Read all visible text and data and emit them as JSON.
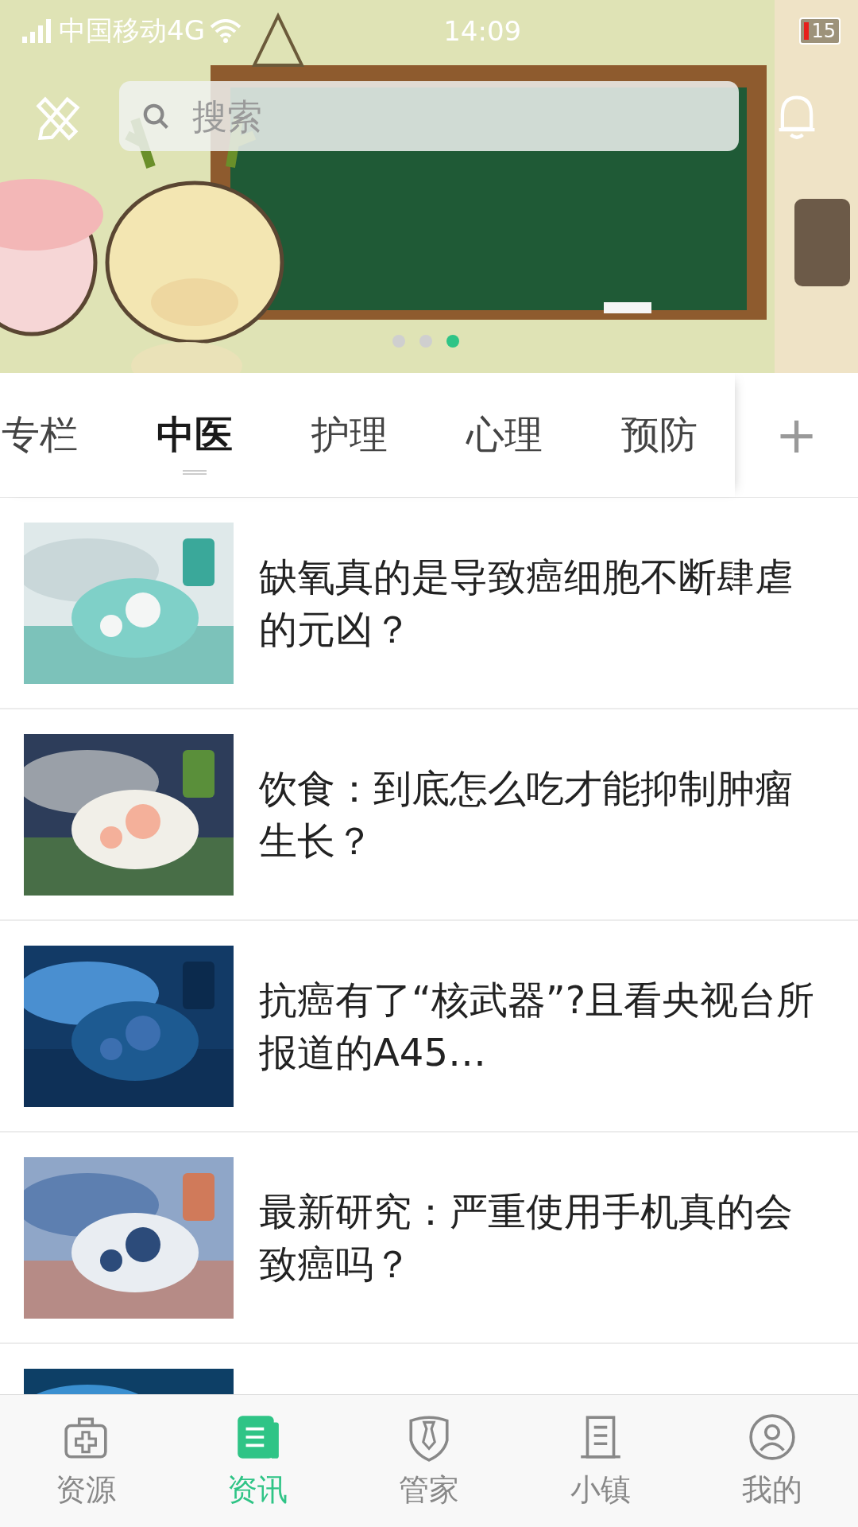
{
  "status_bar": {
    "carrier": "中国移动4G",
    "time": "14:09",
    "battery": "15"
  },
  "search": {
    "placeholder": "搜索"
  },
  "banner": {
    "dots": [
      {
        "selected": false
      },
      {
        "selected": false
      },
      {
        "selected": true
      }
    ]
  },
  "tabs": [
    {
      "label": "专栏",
      "selected": false
    },
    {
      "label": "中医",
      "selected": true
    },
    {
      "label": "护理",
      "selected": false
    },
    {
      "label": "心理",
      "selected": false
    },
    {
      "label": "预防",
      "selected": false
    }
  ],
  "add_tab": "+",
  "articles": [
    {
      "title": "缺氧真的是导致癌细胞不断肆虐的元凶？"
    },
    {
      "title": "饮食：到底怎么吃才能抑制肿瘤生长？"
    },
    {
      "title": "抗癌有了“核武器”?且看央视台所报道的A45…"
    },
    {
      "title": "最新研究：严重使用手机真的会致癌吗？"
    },
    {
      "kind": "picture"
    }
  ],
  "nav": [
    {
      "label": "资源",
      "selected": false
    },
    {
      "label": "资讯",
      "selected": true
    },
    {
      "label": "管家",
      "selected": false
    },
    {
      "label": "小镇",
      "selected": false
    },
    {
      "label": "我的",
      "selected": false
    }
  ]
}
